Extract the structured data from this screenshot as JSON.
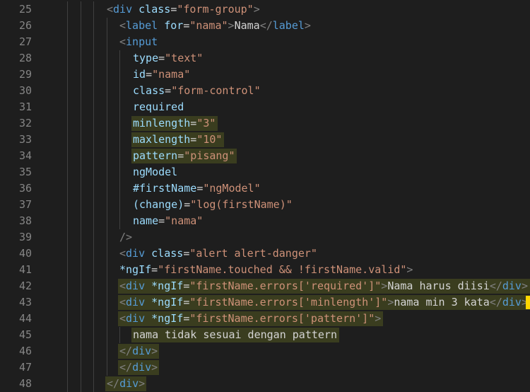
{
  "editor": {
    "lines": [
      {
        "number": "25",
        "level": 3,
        "highlight": false,
        "tokens": [
          {
            "t": "<",
            "c": "punc"
          },
          {
            "t": "div",
            "c": "tag"
          },
          {
            "t": " ",
            "c": "text"
          },
          {
            "t": "class",
            "c": "attr"
          },
          {
            "t": "=",
            "c": "eq"
          },
          {
            "t": "\"form-group\"",
            "c": "str"
          },
          {
            "t": ">",
            "c": "punc"
          }
        ]
      },
      {
        "number": "26",
        "level": 4,
        "highlight": false,
        "tokens": [
          {
            "t": "<",
            "c": "punc"
          },
          {
            "t": "label",
            "c": "tag"
          },
          {
            "t": " ",
            "c": "text"
          },
          {
            "t": "for",
            "c": "attr"
          },
          {
            "t": "=",
            "c": "eq"
          },
          {
            "t": "\"nama\"",
            "c": "str"
          },
          {
            "t": ">",
            "c": "punc"
          },
          {
            "t": "Nama",
            "c": "text"
          },
          {
            "t": "</",
            "c": "punc"
          },
          {
            "t": "label",
            "c": "tag"
          },
          {
            "t": ">",
            "c": "punc"
          }
        ]
      },
      {
        "number": "27",
        "level": 4,
        "highlight": false,
        "tokens": [
          {
            "t": "<",
            "c": "punc"
          },
          {
            "t": "input",
            "c": "tag"
          }
        ]
      },
      {
        "number": "28",
        "level": 5,
        "highlight": false,
        "tokens": [
          {
            "t": "type",
            "c": "attr"
          },
          {
            "t": "=",
            "c": "eq"
          },
          {
            "t": "\"text\"",
            "c": "str"
          }
        ]
      },
      {
        "number": "29",
        "level": 5,
        "highlight": false,
        "tokens": [
          {
            "t": "id",
            "c": "attr"
          },
          {
            "t": "=",
            "c": "eq"
          },
          {
            "t": "\"nama\"",
            "c": "str"
          }
        ]
      },
      {
        "number": "30",
        "level": 5,
        "highlight": false,
        "tokens": [
          {
            "t": "class",
            "c": "attr"
          },
          {
            "t": "=",
            "c": "eq"
          },
          {
            "t": "\"form-control\"",
            "c": "str"
          }
        ]
      },
      {
        "number": "31",
        "level": 5,
        "highlight": false,
        "tokens": [
          {
            "t": "required",
            "c": "attr"
          }
        ]
      },
      {
        "number": "32",
        "level": 5,
        "highlight": true,
        "tokens": [
          {
            "t": "minlength",
            "c": "attr"
          },
          {
            "t": "=",
            "c": "eq"
          },
          {
            "t": "\"3\"",
            "c": "str"
          }
        ]
      },
      {
        "number": "33",
        "level": 5,
        "highlight": true,
        "tokens": [
          {
            "t": "maxlength",
            "c": "attr"
          },
          {
            "t": "=",
            "c": "eq"
          },
          {
            "t": "\"10\"",
            "c": "str"
          }
        ]
      },
      {
        "number": "34",
        "level": 5,
        "highlight": true,
        "tokens": [
          {
            "t": "pattern",
            "c": "attr"
          },
          {
            "t": "=",
            "c": "eq"
          },
          {
            "t": "\"pisang\"",
            "c": "str"
          }
        ]
      },
      {
        "number": "35",
        "level": 5,
        "highlight": false,
        "tokens": [
          {
            "t": "ngModel",
            "c": "attr"
          }
        ]
      },
      {
        "number": "36",
        "level": 5,
        "highlight": false,
        "tokens": [
          {
            "t": "#firstName",
            "c": "attr"
          },
          {
            "t": "=",
            "c": "eq"
          },
          {
            "t": "\"ngModel\"",
            "c": "str"
          }
        ]
      },
      {
        "number": "37",
        "level": 5,
        "highlight": false,
        "tokens": [
          {
            "t": "(change)",
            "c": "attr"
          },
          {
            "t": "=",
            "c": "eq"
          },
          {
            "t": "\"log(firstName)\"",
            "c": "str"
          }
        ]
      },
      {
        "number": "38",
        "level": 5,
        "highlight": false,
        "tokens": [
          {
            "t": "name",
            "c": "attr"
          },
          {
            "t": "=",
            "c": "eq"
          },
          {
            "t": "\"nama\"",
            "c": "str"
          }
        ]
      },
      {
        "number": "39",
        "level": 4,
        "highlight": false,
        "tokens": [
          {
            "t": "/>",
            "c": "punc"
          }
        ]
      },
      {
        "number": "40",
        "level": 4,
        "highlight": false,
        "tokens": [
          {
            "t": "<",
            "c": "punc"
          },
          {
            "t": "div",
            "c": "tag"
          },
          {
            "t": " ",
            "c": "text"
          },
          {
            "t": "class",
            "c": "attr"
          },
          {
            "t": "=",
            "c": "eq"
          },
          {
            "t": "\"alert alert-danger\"",
            "c": "str"
          }
        ]
      },
      {
        "number": "41",
        "level": 4,
        "highlight": false,
        "tokens": [
          {
            "t": "*ngIf",
            "c": "attr"
          },
          {
            "t": "=",
            "c": "eq"
          },
          {
            "t": "\"firstName.touched && !firstName.valid\"",
            "c": "str"
          },
          {
            "t": ">",
            "c": "punc"
          }
        ]
      },
      {
        "number": "42",
        "level": 4,
        "highlight": true,
        "tokens": [
          {
            "t": "<",
            "c": "punc"
          },
          {
            "t": "div",
            "c": "tag"
          },
          {
            "t": " ",
            "c": "text"
          },
          {
            "t": "*ngIf",
            "c": "attr"
          },
          {
            "t": "=",
            "c": "eq"
          },
          {
            "t": "\"firstName.errors['required']\"",
            "c": "str"
          },
          {
            "t": ">",
            "c": "punc"
          },
          {
            "t": "Nama harus diisi",
            "c": "text"
          },
          {
            "t": "</",
            "c": "punc"
          },
          {
            "t": "div",
            "c": "tag"
          },
          {
            "t": ">",
            "c": "punc"
          }
        ]
      },
      {
        "number": "43",
        "level": 4,
        "highlight": true,
        "tokens": [
          {
            "t": "<",
            "c": "punc"
          },
          {
            "t": "div",
            "c": "tag"
          },
          {
            "t": " ",
            "c": "text"
          },
          {
            "t": "*ngIf",
            "c": "attr"
          },
          {
            "t": "=",
            "c": "eq"
          },
          {
            "t": "\"firstName.errors['minlength']\"",
            "c": "str"
          },
          {
            "t": ">",
            "c": "punc"
          },
          {
            "t": "nama min 3 kata",
            "c": "text"
          },
          {
            "t": "</",
            "c": "punc"
          },
          {
            "t": "div",
            "c": "tag"
          },
          {
            "t": ">",
            "c": "punc"
          }
        ]
      },
      {
        "number": "44",
        "level": 4,
        "highlight": true,
        "tokens": [
          {
            "t": "<",
            "c": "punc"
          },
          {
            "t": "div",
            "c": "tag"
          },
          {
            "t": " ",
            "c": "text"
          },
          {
            "t": "*ngIf",
            "c": "attr"
          },
          {
            "t": "=",
            "c": "eq"
          },
          {
            "t": "\"firstName.errors['pattern']\"",
            "c": "str"
          },
          {
            "t": ">",
            "c": "punc"
          }
        ]
      },
      {
        "number": "45",
        "level": 5,
        "highlight": true,
        "tokens": [
          {
            "t": "nama tidak sesuai dengan pattern",
            "c": "text"
          }
        ]
      },
      {
        "number": "46",
        "level": 4,
        "highlight": true,
        "tokens": [
          {
            "t": "</",
            "c": "punc"
          },
          {
            "t": "div",
            "c": "tag"
          },
          {
            "t": ">",
            "c": "punc"
          }
        ]
      },
      {
        "number": "47",
        "level": 4,
        "highlight": true,
        "tokens": [
          {
            "t": "</",
            "c": "punc"
          },
          {
            "t": "div",
            "c": "tag"
          },
          {
            "t": ">",
            "c": "punc"
          }
        ]
      },
      {
        "number": "48",
        "level": 3,
        "highlight": true,
        "tokens": [
          {
            "t": "</",
            "c": "punc"
          },
          {
            "t": "div",
            "c": "tag"
          },
          {
            "t": ">",
            "c": "punc"
          }
        ]
      }
    ]
  },
  "colors": {
    "background": "#1e1e1e",
    "line_number": "#858585",
    "punctuation": "#808080",
    "tag": "#569cd6",
    "attribute": "#9cdcfe",
    "string": "#ce9178",
    "text": "#d4d4d4",
    "highlight": "#3a3d1f",
    "marker": "#ffd700"
  }
}
